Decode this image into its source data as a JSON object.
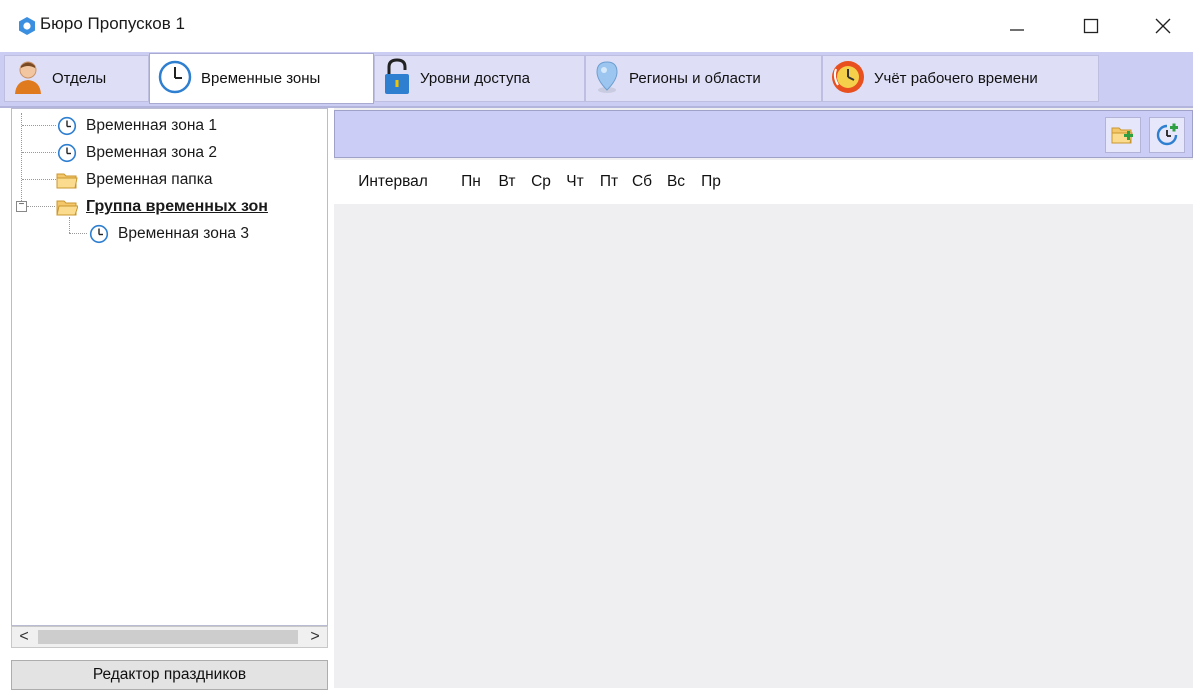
{
  "window": {
    "title": "Бюро Пропусков 1",
    "controls": {
      "minimize": "minimize",
      "maximize": "maximize",
      "close": "close"
    }
  },
  "tabs": [
    {
      "label": "Отделы",
      "icon": "person-icon",
      "active": false
    },
    {
      "label": "Временные зоны",
      "icon": "clock-icon",
      "active": true
    },
    {
      "label": "Уровни доступа",
      "icon": "padlock-icon",
      "active": false
    },
    {
      "label": "Регионы и области",
      "icon": "map-pin-icon",
      "active": false
    },
    {
      "label": "Учёт рабочего времени",
      "icon": "timesheet-clock-icon",
      "active": false
    }
  ],
  "tree": {
    "items": [
      {
        "label": "Временная зона 1",
        "icon": "clock-icon",
        "level": 0
      },
      {
        "label": "Временная зона 2",
        "icon": "clock-icon",
        "level": 0
      },
      {
        "label": "Временная папка",
        "icon": "folder-icon",
        "level": 0
      },
      {
        "label": "Группа временных зон",
        "icon": "open-folder-icon",
        "level": 0,
        "expanded": true,
        "selected": true
      },
      {
        "label": "Временная зона 3",
        "icon": "clock-icon",
        "level": 1
      }
    ]
  },
  "scrollbar": {
    "left_arrow": "<",
    "right_arrow": ">"
  },
  "holiday_editor": {
    "label": "Редактор праздников"
  },
  "toolbar": {
    "buttons": [
      {
        "name": "add-folder",
        "icon": "add-folder-icon"
      },
      {
        "name": "add-time-zone",
        "icon": "add-clock-icon"
      }
    ]
  },
  "table": {
    "columns": [
      "Интервал",
      "Пн",
      "Вт",
      "Ср",
      "Чт",
      "Пт",
      "Сб",
      "Вс",
      "Пр"
    ]
  },
  "colors": {
    "tab_bar": "#cccdf2",
    "toolbar": "#cccdf7",
    "panel_bg": "#efeff2",
    "accent_blue": "#2f7fd1"
  }
}
